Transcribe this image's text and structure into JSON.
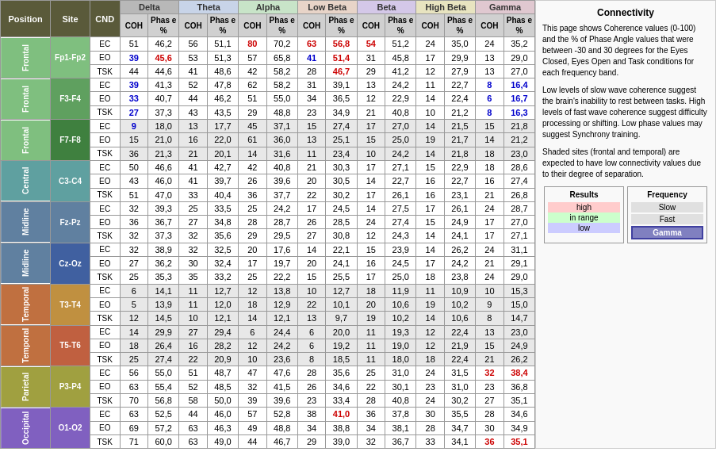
{
  "bands": {
    "delta": "Delta",
    "theta": "Theta",
    "alpha": "Alpha",
    "lowbeta": "Low Beta",
    "beta": "Beta",
    "highbeta": "High Beta",
    "gamma": "Gamma"
  },
  "cols": {
    "position": "Position",
    "site": "Site",
    "cnd": "CND",
    "coh": "COH",
    "phase": "Phas e %"
  },
  "info": {
    "title": "Connectivity",
    "body1": "This page shows Coherence values (0-100) and the % of Phase Angle values that were between -30 and 30 degrees for the Eyes Closed, Eyes Open and Task conditions for each frequency band.",
    "body2": "Low levels of slow wave coherence suggest the brain's inability to rest between tasks. High levels of fast wave coherence suggest difficulty processing or shifting. Low phase values may suggest Synchrony training.",
    "body3": "Shaded sites (frontal and temporal) are expected to have low connectivity values due to their degree of separation.",
    "results_title": "Results",
    "freq_title": "Frequency",
    "legend_high": "high",
    "legend_mid": "in range",
    "legend_low": "low",
    "freq_slow": "Slow",
    "freq_fast": "Fast",
    "freq_gamma": "Gamma"
  },
  "rows": [
    {
      "position": "Frontal",
      "site": "Fp1-Fp2",
      "cnd": "EC",
      "delta_coh": "51",
      "delta_phase": "46,2",
      "theta_coh": "56",
      "theta_phase": "51,1",
      "alpha_coh": "80",
      "alpha_phase": "70,2",
      "lowbeta_coh": "63",
      "lowbeta_phase": "56,8",
      "beta_coh": "54",
      "beta_phase": "51,2",
      "highbeta_coh": "24",
      "highbeta_phase": "35,0",
      "gamma_coh": "24",
      "gamma_phase": "35,2",
      "alpha_coh_high": true,
      "lowbeta_coh_high": true,
      "lowbeta_phase_high": true,
      "beta_coh_high": true
    },
    {
      "position": "Frontal",
      "site": "Fp1-Fp2",
      "cnd": "EO",
      "delta_coh": "39",
      "delta_phase": "45,6",
      "theta_coh": "53",
      "theta_phase": "51,3",
      "alpha_coh": "57",
      "alpha_phase": "65,8",
      "lowbeta_coh": "41",
      "lowbeta_phase": "51,4",
      "beta_coh": "31",
      "beta_phase": "45,8",
      "highbeta_coh": "17",
      "highbeta_phase": "29,9",
      "gamma_coh": "13",
      "gamma_phase": "29,0",
      "delta_coh_low": true,
      "delta_phase_high": true,
      "lowbeta_coh_low": true,
      "lowbeta_phase_high": true
    },
    {
      "position": "Frontal",
      "site": "Fp1-Fp2",
      "cnd": "TSK",
      "delta_coh": "44",
      "delta_phase": "44,6",
      "theta_coh": "41",
      "theta_phase": "48,6",
      "alpha_coh": "42",
      "alpha_phase": "58,2",
      "lowbeta_coh": "28",
      "lowbeta_phase": "46,7",
      "beta_coh": "29",
      "beta_phase": "41,2",
      "highbeta_coh": "12",
      "highbeta_phase": "27,9",
      "gamma_coh": "13",
      "gamma_phase": "27,0",
      "lowbeta_phase_high": true
    },
    {
      "position": "Frontal",
      "site": "F3-F4",
      "cnd": "EC",
      "delta_coh": "39",
      "delta_phase": "41,3",
      "theta_coh": "52",
      "theta_phase": "47,8",
      "alpha_coh": "62",
      "alpha_phase": "58,2",
      "lowbeta_coh": "31",
      "lowbeta_phase": "39,1",
      "beta_coh": "13",
      "beta_phase": "24,2",
      "highbeta_coh": "11",
      "highbeta_phase": "22,7",
      "gamma_coh": "8",
      "gamma_phase": "16,4",
      "delta_coh_low": true,
      "gamma_coh_low": true,
      "gamma_phase_low": true
    },
    {
      "position": "Frontal",
      "site": "F3-F4",
      "cnd": "EO",
      "delta_coh": "33",
      "delta_phase": "40,7",
      "theta_coh": "44",
      "theta_phase": "46,2",
      "alpha_coh": "51",
      "alpha_phase": "55,0",
      "lowbeta_coh": "34",
      "lowbeta_phase": "36,5",
      "beta_coh": "12",
      "beta_phase": "22,9",
      "highbeta_coh": "14",
      "highbeta_phase": "22,4",
      "gamma_coh": "6",
      "gamma_phase": "16,7",
      "delta_coh_low": true,
      "gamma_coh_low": true,
      "gamma_phase_low": true
    },
    {
      "position": "Frontal",
      "site": "F3-F4",
      "cnd": "TSK",
      "delta_coh": "27",
      "delta_phase": "37,3",
      "theta_coh": "43",
      "theta_phase": "43,5",
      "alpha_coh": "29",
      "alpha_phase": "48,8",
      "lowbeta_coh": "23",
      "lowbeta_phase": "34,9",
      "beta_coh": "21",
      "beta_phase": "40,8",
      "highbeta_coh": "10",
      "highbeta_phase": "21,2",
      "gamma_coh": "8",
      "gamma_phase": "16,3",
      "delta_coh_low": true,
      "gamma_coh_low": true,
      "gamma_phase_low": true
    },
    {
      "position": "Frontal",
      "site": "F7-F8",
      "cnd": "EC",
      "delta_coh": "9",
      "delta_phase": "18,0",
      "theta_coh": "13",
      "theta_phase": "17,7",
      "alpha_coh": "45",
      "alpha_phase": "37,1",
      "lowbeta_coh": "15",
      "lowbeta_phase": "27,4",
      "beta_coh": "17",
      "beta_phase": "27,0",
      "highbeta_coh": "14",
      "highbeta_phase": "21,5",
      "gamma_coh": "15",
      "gamma_phase": "21,8",
      "delta_coh_low": true
    },
    {
      "position": "Frontal",
      "site": "F7-F8",
      "cnd": "EO",
      "delta_coh": "15",
      "delta_phase": "21,0",
      "theta_coh": "16",
      "theta_phase": "22,0",
      "alpha_coh": "61",
      "alpha_phase": "36,0",
      "lowbeta_coh": "13",
      "lowbeta_phase": "25,1",
      "beta_coh": "15",
      "beta_phase": "25,0",
      "highbeta_coh": "19",
      "highbeta_phase": "21,7",
      "gamma_coh": "14",
      "gamma_phase": "21,2"
    },
    {
      "position": "Frontal",
      "site": "F7-F8",
      "cnd": "TSK",
      "delta_coh": "36",
      "delta_phase": "21,3",
      "theta_coh": "21",
      "theta_phase": "20,1",
      "alpha_coh": "14",
      "alpha_phase": "31,6",
      "lowbeta_coh": "11",
      "lowbeta_phase": "23,4",
      "beta_coh": "10",
      "beta_phase": "24,2",
      "highbeta_coh": "14",
      "highbeta_phase": "21,8",
      "gamma_coh": "18",
      "gamma_phase": "23,0"
    },
    {
      "position": "Central",
      "site": "C3-C4",
      "cnd": "EC",
      "delta_coh": "50",
      "delta_phase": "46,6",
      "theta_coh": "41",
      "theta_phase": "42,7",
      "alpha_coh": "42",
      "alpha_phase": "40,8",
      "lowbeta_coh": "21",
      "lowbeta_phase": "30,3",
      "beta_coh": "17",
      "beta_phase": "27,1",
      "highbeta_coh": "15",
      "highbeta_phase": "22,9",
      "gamma_coh": "18",
      "gamma_phase": "28,6"
    },
    {
      "position": "Central",
      "site": "C3-C4",
      "cnd": "EO",
      "delta_coh": "43",
      "delta_phase": "46,0",
      "theta_coh": "41",
      "theta_phase": "39,7",
      "alpha_coh": "26",
      "alpha_phase": "39,6",
      "lowbeta_coh": "20",
      "lowbeta_phase": "30,5",
      "beta_coh": "14",
      "beta_phase": "22,7",
      "highbeta_coh": "16",
      "highbeta_phase": "22,7",
      "gamma_coh": "16",
      "gamma_phase": "27,4"
    },
    {
      "position": "Central",
      "site": "C3-C4",
      "cnd": "TSK",
      "delta_coh": "51",
      "delta_phase": "47,0",
      "theta_coh": "33",
      "theta_phase": "40,4",
      "alpha_coh": "36",
      "alpha_phase": "37,7",
      "lowbeta_coh": "22",
      "lowbeta_phase": "30,2",
      "beta_coh": "17",
      "beta_phase": "26,1",
      "highbeta_coh": "16",
      "highbeta_phase": "23,1",
      "gamma_coh": "21",
      "gamma_phase": "26,8"
    },
    {
      "position": "Midline",
      "site": "Fz-Pz",
      "cnd": "EC",
      "delta_coh": "32",
      "delta_phase": "39,3",
      "theta_coh": "25",
      "theta_phase": "33,5",
      "alpha_coh": "25",
      "alpha_phase": "24,2",
      "lowbeta_coh": "17",
      "lowbeta_phase": "24,5",
      "beta_coh": "14",
      "beta_phase": "27,5",
      "highbeta_coh": "17",
      "highbeta_phase": "26,1",
      "gamma_coh": "24",
      "gamma_phase": "28,7"
    },
    {
      "position": "Midline",
      "site": "Fz-Pz",
      "cnd": "EO",
      "delta_coh": "36",
      "delta_phase": "36,7",
      "theta_coh": "27",
      "theta_phase": "34,8",
      "alpha_coh": "28",
      "alpha_phase": "28,7",
      "lowbeta_coh": "26",
      "lowbeta_phase": "28,5",
      "beta_coh": "24",
      "beta_phase": "27,4",
      "highbeta_coh": "15",
      "highbeta_phase": "24,9",
      "gamma_coh": "17",
      "gamma_phase": "27,0"
    },
    {
      "position": "Midline",
      "site": "Fz-Pz",
      "cnd": "TSK",
      "delta_coh": "32",
      "delta_phase": "37,3",
      "theta_coh": "32",
      "theta_phase": "35,6",
      "alpha_coh": "29",
      "alpha_phase": "29,5",
      "lowbeta_coh": "27",
      "lowbeta_phase": "30,8",
      "beta_coh": "12",
      "beta_phase": "24,3",
      "highbeta_coh": "14",
      "highbeta_phase": "24,1",
      "gamma_coh": "17",
      "gamma_phase": "27,1"
    },
    {
      "position": "Midline",
      "site": "Cz-Oz",
      "cnd": "EC",
      "delta_coh": "32",
      "delta_phase": "38,9",
      "theta_coh": "32",
      "theta_phase": "32,5",
      "alpha_coh": "20",
      "alpha_phase": "17,6",
      "lowbeta_coh": "14",
      "lowbeta_phase": "22,1",
      "beta_coh": "15",
      "beta_phase": "23,9",
      "highbeta_coh": "14",
      "highbeta_phase": "26,2",
      "gamma_coh": "24",
      "gamma_phase": "31,1"
    },
    {
      "position": "Midline",
      "site": "Cz-Oz",
      "cnd": "EO",
      "delta_coh": "27",
      "delta_phase": "36,2",
      "theta_coh": "30",
      "theta_phase": "32,4",
      "alpha_coh": "17",
      "alpha_phase": "19,7",
      "lowbeta_coh": "20",
      "lowbeta_phase": "24,1",
      "beta_coh": "16",
      "beta_phase": "24,5",
      "highbeta_coh": "17",
      "highbeta_phase": "24,2",
      "gamma_coh": "21",
      "gamma_phase": "29,1"
    },
    {
      "position": "Midline",
      "site": "Cz-Oz",
      "cnd": "TSK",
      "delta_coh": "25",
      "delta_phase": "35,3",
      "theta_coh": "35",
      "theta_phase": "33,2",
      "alpha_coh": "25",
      "alpha_phase": "22,2",
      "lowbeta_coh": "15",
      "lowbeta_phase": "25,5",
      "beta_coh": "17",
      "beta_phase": "25,0",
      "highbeta_coh": "18",
      "highbeta_phase": "23,8",
      "gamma_coh": "24",
      "gamma_phase": "29,0"
    },
    {
      "position": "Temporal",
      "site": "T3-T4",
      "cnd": "EC",
      "delta_coh": "6",
      "delta_phase": "14,1",
      "theta_coh": "11",
      "theta_phase": "12,7",
      "alpha_coh": "12",
      "alpha_phase": "13,8",
      "lowbeta_coh": "10",
      "lowbeta_phase": "12,7",
      "beta_coh": "18",
      "beta_phase": "11,9",
      "highbeta_coh": "11",
      "highbeta_phase": "10,9",
      "gamma_coh": "10",
      "gamma_phase": "15,3"
    },
    {
      "position": "Temporal",
      "site": "T3-T4",
      "cnd": "EO",
      "delta_coh": "5",
      "delta_phase": "13,9",
      "theta_coh": "11",
      "theta_phase": "12,0",
      "alpha_coh": "18",
      "alpha_phase": "12,9",
      "lowbeta_coh": "22",
      "lowbeta_phase": "10,1",
      "beta_coh": "20",
      "beta_phase": "10,6",
      "highbeta_coh": "19",
      "highbeta_phase": "10,2",
      "gamma_coh": "9",
      "gamma_phase": "15,0"
    },
    {
      "position": "Temporal",
      "site": "T3-T4",
      "cnd": "TSK",
      "delta_coh": "12",
      "delta_phase": "14,5",
      "theta_coh": "10",
      "theta_phase": "12,1",
      "alpha_coh": "14",
      "alpha_phase": "12,1",
      "lowbeta_coh": "13",
      "lowbeta_phase": "9,7",
      "beta_coh": "19",
      "beta_phase": "10,2",
      "highbeta_coh": "14",
      "highbeta_phase": "10,6",
      "gamma_coh": "8",
      "gamma_phase": "14,7"
    },
    {
      "position": "Temporal",
      "site": "T5-T6",
      "cnd": "EC",
      "delta_coh": "14",
      "delta_phase": "29,9",
      "theta_coh": "27",
      "theta_phase": "29,4",
      "alpha_coh": "6",
      "alpha_phase": "24,4",
      "lowbeta_coh": "6",
      "lowbeta_phase": "20,0",
      "beta_coh": "11",
      "beta_phase": "19,3",
      "highbeta_coh": "12",
      "highbeta_phase": "22,4",
      "gamma_coh": "13",
      "gamma_phase": "23,0"
    },
    {
      "position": "Temporal",
      "site": "T5-T6",
      "cnd": "EO",
      "delta_coh": "18",
      "delta_phase": "26,4",
      "theta_coh": "16",
      "theta_phase": "28,2",
      "alpha_coh": "12",
      "alpha_phase": "24,2",
      "lowbeta_coh": "6",
      "lowbeta_phase": "19,2",
      "beta_coh": "11",
      "beta_phase": "19,0",
      "highbeta_coh": "12",
      "highbeta_phase": "21,9",
      "gamma_coh": "15",
      "gamma_phase": "24,9"
    },
    {
      "position": "Temporal",
      "site": "T5-T6",
      "cnd": "TSK",
      "delta_coh": "25",
      "delta_phase": "27,4",
      "theta_coh": "22",
      "theta_phase": "20,9",
      "alpha_coh": "10",
      "alpha_phase": "23,6",
      "lowbeta_coh": "8",
      "lowbeta_phase": "18,5",
      "beta_coh": "11",
      "beta_phase": "18,0",
      "highbeta_coh": "18",
      "highbeta_phase": "22,4",
      "gamma_coh": "21",
      "gamma_phase": "26,2"
    },
    {
      "position": "Parietal",
      "site": "P3-P4",
      "cnd": "EC",
      "delta_coh": "56",
      "delta_phase": "55,0",
      "theta_coh": "51",
      "theta_phase": "48,7",
      "alpha_coh": "47",
      "alpha_phase": "47,6",
      "lowbeta_coh": "28",
      "lowbeta_phase": "35,6",
      "beta_coh": "25",
      "beta_phase": "31,0",
      "highbeta_coh": "24",
      "highbeta_phase": "31,5",
      "gamma_coh": "32",
      "gamma_phase": "38,4",
      "gamma_coh_high": true,
      "gamma_phase_high": true
    },
    {
      "position": "Parietal",
      "site": "P3-P4",
      "cnd": "EO",
      "delta_coh": "63",
      "delta_phase": "55,4",
      "theta_coh": "52",
      "theta_phase": "48,5",
      "alpha_coh": "32",
      "alpha_phase": "41,5",
      "lowbeta_coh": "26",
      "lowbeta_phase": "34,6",
      "beta_coh": "22",
      "beta_phase": "30,1",
      "highbeta_coh": "23",
      "highbeta_phase": "31,0",
      "gamma_coh": "23",
      "gamma_phase": "36,8"
    },
    {
      "position": "Parietal",
      "site": "P3-P4",
      "cnd": "TSK",
      "delta_coh": "70",
      "delta_phase": "56,8",
      "theta_coh": "58",
      "theta_phase": "50,0",
      "alpha_coh": "39",
      "alpha_phase": "39,6",
      "lowbeta_coh": "23",
      "lowbeta_phase": "33,4",
      "beta_coh": "28",
      "beta_phase": "40,8",
      "highbeta_coh": "24",
      "highbeta_phase": "30,2",
      "gamma_coh": "27",
      "gamma_phase": "35,1"
    },
    {
      "position": "Occipital",
      "site": "O1-O2",
      "cnd": "EC",
      "delta_coh": "63",
      "delta_phase": "52,5",
      "theta_coh": "44",
      "theta_phase": "46,0",
      "alpha_coh": "57",
      "alpha_phase": "52,8",
      "lowbeta_coh": "38",
      "lowbeta_phase": "41,0",
      "beta_coh": "36",
      "beta_phase": "37,8",
      "highbeta_coh": "30",
      "highbeta_phase": "35,5",
      "gamma_coh": "28",
      "gamma_phase": "34,6",
      "lowbeta_phase_high": true
    },
    {
      "position": "Occipital",
      "site": "O1-O2",
      "cnd": "EO",
      "delta_coh": "69",
      "delta_phase": "57,2",
      "theta_coh": "63",
      "theta_phase": "46,3",
      "alpha_coh": "49",
      "alpha_phase": "48,8",
      "lowbeta_coh": "34",
      "lowbeta_phase": "38,8",
      "beta_coh": "34",
      "beta_phase": "38,1",
      "highbeta_coh": "28",
      "highbeta_phase": "34,7",
      "gamma_coh": "30",
      "gamma_phase": "34,9"
    },
    {
      "position": "Occipital",
      "site": "O1-O2",
      "cnd": "TSK",
      "delta_coh": "71",
      "delta_phase": "60,0",
      "theta_coh": "63",
      "theta_phase": "49,0",
      "alpha_coh": "44",
      "alpha_phase": "46,7",
      "lowbeta_coh": "29",
      "lowbeta_phase": "39,0",
      "beta_coh": "32",
      "beta_phase": "36,7",
      "highbeta_coh": "33",
      "highbeta_phase": "34,1",
      "gamma_coh": "36",
      "gamma_phase": "35,1",
      "gamma_coh_high": true,
      "gamma_phase_high": true
    }
  ]
}
